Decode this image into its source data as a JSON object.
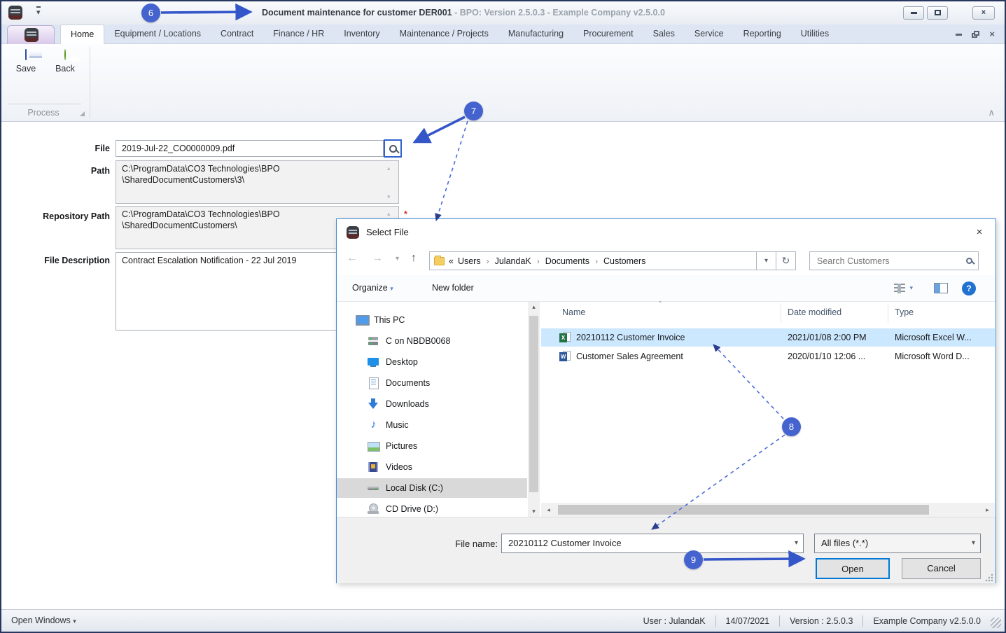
{
  "window": {
    "title_main": "Document maintenance for customer DER001",
    "title_rest": " - BPO: Version 2.5.0.3 - Example Company v2.5.0.0"
  },
  "ribbon": {
    "tabs": [
      "Home",
      "Equipment / Locations",
      "Contract",
      "Finance / HR",
      "Inventory",
      "Maintenance / Projects",
      "Manufacturing",
      "Procurement",
      "Sales",
      "Service",
      "Reporting",
      "Utilities"
    ],
    "active_tab": "Home",
    "save_label": "Save",
    "back_label": "Back",
    "group_label": "Process"
  },
  "form": {
    "file_label": "File",
    "file_value": "2019-Jul-22_CO0000009.pdf",
    "path_label": "Path",
    "path_value": "C:\\ProgramData\\CO3 Technologies\\BPO\n\\SharedDocumentCustomers\\3\\",
    "repository_label": "Repository Path",
    "repository_value": "C:\\ProgramData\\CO3 Technologies\\BPO\n\\SharedDocumentCustomers\\",
    "required_marker": "*",
    "description_label": "File Description",
    "description_value": "Contract Escalation Notification - 22 Jul 2019"
  },
  "dialog": {
    "title": "Select File",
    "breadcrumb_prefix": "«",
    "breadcrumb": [
      "Users",
      "JulandaK",
      "Documents",
      "Customers"
    ],
    "search_placeholder": "Search Customers",
    "organize_label": "Organize",
    "new_folder_label": "New folder",
    "sidebar": [
      {
        "label": "This PC"
      },
      {
        "label": "C on NBDB0068"
      },
      {
        "label": "Desktop"
      },
      {
        "label": "Documents"
      },
      {
        "label": "Downloads"
      },
      {
        "label": "Music"
      },
      {
        "label": "Pictures"
      },
      {
        "label": "Videos"
      },
      {
        "label": "Local Disk (C:)"
      },
      {
        "label": "CD Drive (D:)"
      }
    ],
    "columns": {
      "name": "Name",
      "date": "Date modified",
      "type": "Type"
    },
    "files": [
      {
        "name": "20210112 Customer Invoice",
        "date": "2021/01/08 2:00 PM",
        "type": "Microsoft Excel W...",
        "selected": true
      },
      {
        "name": "Customer Sales Agreement",
        "date": "2020/01/10 12:06 ...",
        "type": "Microsoft Word D...",
        "selected": false
      }
    ],
    "file_name_label": "File name:",
    "file_name_value": "20210112 Customer Invoice",
    "file_type_value": "All files (*.*)",
    "open_label": "Open",
    "cancel_label": "Cancel"
  },
  "statusbar": {
    "open_windows": "Open Windows",
    "user": "User : JulandaK",
    "date": "14/07/2021",
    "version": "Version : 2.5.0.3",
    "company": "Example Company v2.5.0.0"
  },
  "callouts": {
    "six": "6",
    "seven": "7",
    "eight": "8",
    "nine": "9"
  },
  "icons": {
    "dropdown": "▾",
    "up_arrow": "↑",
    "back_arrow": "←",
    "forward_arrow": "→",
    "refresh": "↻",
    "crumb_sep": "›",
    "scroll_up": "▴",
    "scroll_down": "▾",
    "scroll_left": "◂",
    "scroll_right": "▸",
    "close": "×",
    "sort": "ˆ",
    "music_note": "♪",
    "help": "?",
    "collapse": "∧"
  },
  "colors": {
    "accent": "#4563cf",
    "selection": "#cce8ff",
    "default_button_border": "#0078d7",
    "sidebar_selection": "#d9d9d9"
  }
}
